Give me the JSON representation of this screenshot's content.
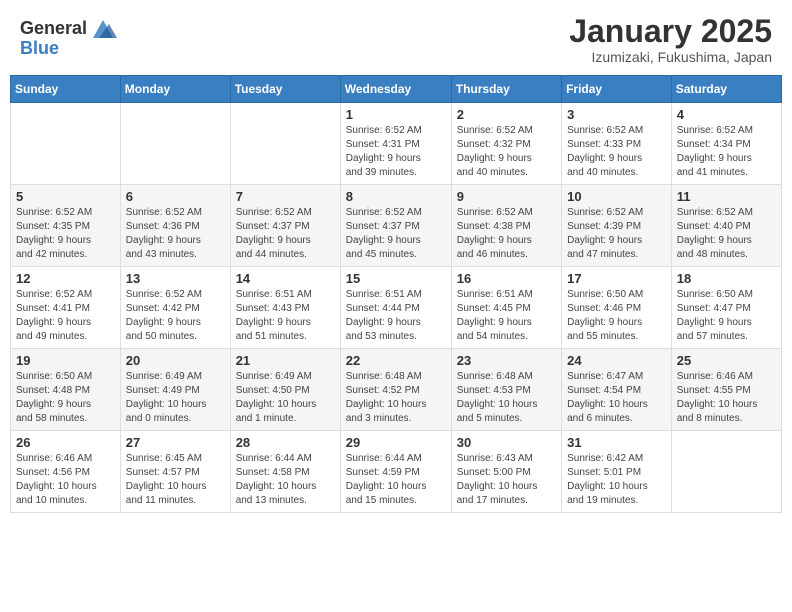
{
  "header": {
    "logo_general": "General",
    "logo_blue": "Blue",
    "month_title": "January 2025",
    "location": "Izumizaki, Fukushima, Japan"
  },
  "weekdays": [
    "Sunday",
    "Monday",
    "Tuesday",
    "Wednesday",
    "Thursday",
    "Friday",
    "Saturday"
  ],
  "weeks": [
    [
      {
        "day": "",
        "info": ""
      },
      {
        "day": "",
        "info": ""
      },
      {
        "day": "",
        "info": ""
      },
      {
        "day": "1",
        "info": "Sunrise: 6:52 AM\nSunset: 4:31 PM\nDaylight: 9 hours\nand 39 minutes."
      },
      {
        "day": "2",
        "info": "Sunrise: 6:52 AM\nSunset: 4:32 PM\nDaylight: 9 hours\nand 40 minutes."
      },
      {
        "day": "3",
        "info": "Sunrise: 6:52 AM\nSunset: 4:33 PM\nDaylight: 9 hours\nand 40 minutes."
      },
      {
        "day": "4",
        "info": "Sunrise: 6:52 AM\nSunset: 4:34 PM\nDaylight: 9 hours\nand 41 minutes."
      }
    ],
    [
      {
        "day": "5",
        "info": "Sunrise: 6:52 AM\nSunset: 4:35 PM\nDaylight: 9 hours\nand 42 minutes."
      },
      {
        "day": "6",
        "info": "Sunrise: 6:52 AM\nSunset: 4:36 PM\nDaylight: 9 hours\nand 43 minutes."
      },
      {
        "day": "7",
        "info": "Sunrise: 6:52 AM\nSunset: 4:37 PM\nDaylight: 9 hours\nand 44 minutes."
      },
      {
        "day": "8",
        "info": "Sunrise: 6:52 AM\nSunset: 4:37 PM\nDaylight: 9 hours\nand 45 minutes."
      },
      {
        "day": "9",
        "info": "Sunrise: 6:52 AM\nSunset: 4:38 PM\nDaylight: 9 hours\nand 46 minutes."
      },
      {
        "day": "10",
        "info": "Sunrise: 6:52 AM\nSunset: 4:39 PM\nDaylight: 9 hours\nand 47 minutes."
      },
      {
        "day": "11",
        "info": "Sunrise: 6:52 AM\nSunset: 4:40 PM\nDaylight: 9 hours\nand 48 minutes."
      }
    ],
    [
      {
        "day": "12",
        "info": "Sunrise: 6:52 AM\nSunset: 4:41 PM\nDaylight: 9 hours\nand 49 minutes."
      },
      {
        "day": "13",
        "info": "Sunrise: 6:52 AM\nSunset: 4:42 PM\nDaylight: 9 hours\nand 50 minutes."
      },
      {
        "day": "14",
        "info": "Sunrise: 6:51 AM\nSunset: 4:43 PM\nDaylight: 9 hours\nand 51 minutes."
      },
      {
        "day": "15",
        "info": "Sunrise: 6:51 AM\nSunset: 4:44 PM\nDaylight: 9 hours\nand 53 minutes."
      },
      {
        "day": "16",
        "info": "Sunrise: 6:51 AM\nSunset: 4:45 PM\nDaylight: 9 hours\nand 54 minutes."
      },
      {
        "day": "17",
        "info": "Sunrise: 6:50 AM\nSunset: 4:46 PM\nDaylight: 9 hours\nand 55 minutes."
      },
      {
        "day": "18",
        "info": "Sunrise: 6:50 AM\nSunset: 4:47 PM\nDaylight: 9 hours\nand 57 minutes."
      }
    ],
    [
      {
        "day": "19",
        "info": "Sunrise: 6:50 AM\nSunset: 4:48 PM\nDaylight: 9 hours\nand 58 minutes."
      },
      {
        "day": "20",
        "info": "Sunrise: 6:49 AM\nSunset: 4:49 PM\nDaylight: 10 hours\nand 0 minutes."
      },
      {
        "day": "21",
        "info": "Sunrise: 6:49 AM\nSunset: 4:50 PM\nDaylight: 10 hours\nand 1 minute."
      },
      {
        "day": "22",
        "info": "Sunrise: 6:48 AM\nSunset: 4:52 PM\nDaylight: 10 hours\nand 3 minutes."
      },
      {
        "day": "23",
        "info": "Sunrise: 6:48 AM\nSunset: 4:53 PM\nDaylight: 10 hours\nand 5 minutes."
      },
      {
        "day": "24",
        "info": "Sunrise: 6:47 AM\nSunset: 4:54 PM\nDaylight: 10 hours\nand 6 minutes."
      },
      {
        "day": "25",
        "info": "Sunrise: 6:46 AM\nSunset: 4:55 PM\nDaylight: 10 hours\nand 8 minutes."
      }
    ],
    [
      {
        "day": "26",
        "info": "Sunrise: 6:46 AM\nSunset: 4:56 PM\nDaylight: 10 hours\nand 10 minutes."
      },
      {
        "day": "27",
        "info": "Sunrise: 6:45 AM\nSunset: 4:57 PM\nDaylight: 10 hours\nand 11 minutes."
      },
      {
        "day": "28",
        "info": "Sunrise: 6:44 AM\nSunset: 4:58 PM\nDaylight: 10 hours\nand 13 minutes."
      },
      {
        "day": "29",
        "info": "Sunrise: 6:44 AM\nSunset: 4:59 PM\nDaylight: 10 hours\nand 15 minutes."
      },
      {
        "day": "30",
        "info": "Sunrise: 6:43 AM\nSunset: 5:00 PM\nDaylight: 10 hours\nand 17 minutes."
      },
      {
        "day": "31",
        "info": "Sunrise: 6:42 AM\nSunset: 5:01 PM\nDaylight: 10 hours\nand 19 minutes."
      },
      {
        "day": "",
        "info": ""
      }
    ]
  ]
}
